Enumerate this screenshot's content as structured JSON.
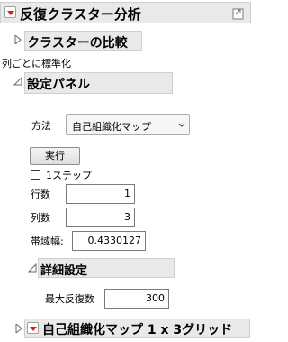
{
  "colors": {
    "accent_red": "#d42020",
    "header_bg": "#e9e9e9",
    "disclosure_gray": "#6a6a6a"
  },
  "report": {
    "title": "反復クラスター分析",
    "compare_section": "クラスターの比較",
    "standardize_label": "列ごとに標準化",
    "settings_panel": {
      "title": "設定パネル",
      "method_label": "方法",
      "method_value": "自己組織化マップ",
      "run_button": "実行",
      "step_checkbox_label": "1ステップ",
      "step_checked": false,
      "rows_label": "行数",
      "rows_value": "1",
      "cols_label": "列数",
      "cols_value": "3",
      "bandwidth_label": "帯域幅:",
      "bandwidth_value": "0.4330127",
      "advanced": {
        "title": "詳細設定",
        "max_iter_label": "最大反復数",
        "max_iter_value": "300"
      }
    },
    "som_section": "自己組織化マップ 1 x 3グリッド"
  },
  "icons": {
    "corner": "popout-icon",
    "red_menu": "red-triangle-menu-icon",
    "disclosure_closed": "disclosure-closed-icon",
    "disclosure_open": "disclosure-open-icon",
    "dropdown": "chevron-down-icon"
  }
}
